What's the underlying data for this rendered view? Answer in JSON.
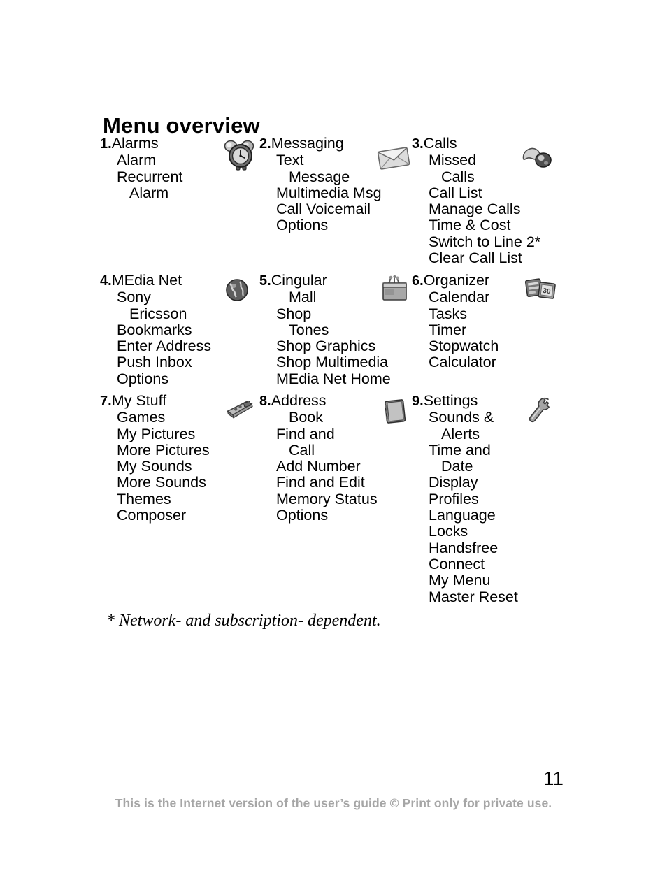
{
  "document": {
    "title": "Menu overview",
    "page_number": "11",
    "footnote": "* Network- and subscription- dependent.",
    "footer": "This is the Internet version of the user’s guide © Print only for private use.",
    "footer_color": "#a6a6a6"
  },
  "menu": {
    "sections": [
      {
        "number": "1.",
        "title": "Alarms",
        "icon": "alarm-clock-icon",
        "items": [
          {
            "text": "Alarm",
            "indent": false
          },
          {
            "text": "Recurrent",
            "indent": false
          },
          {
            "text": "Alarm",
            "indent": true
          }
        ]
      },
      {
        "number": "2.",
        "title": "Messaging",
        "icon": "envelope-icon",
        "items": [
          {
            "text": "Text",
            "indent": false
          },
          {
            "text": "Message",
            "indent": true
          },
          {
            "text": "Multimedia Msg",
            "indent": false
          },
          {
            "text": "Call Voicemail",
            "indent": false
          },
          {
            "text": "Options",
            "indent": false
          }
        ]
      },
      {
        "number": "3.",
        "title": "Calls",
        "icon": "phone-handset-icon",
        "items": [
          {
            "text": "Missed",
            "indent": false
          },
          {
            "text": "Calls",
            "indent": true
          },
          {
            "text": "Call List",
            "indent": false
          },
          {
            "text": "Manage Calls",
            "indent": false
          },
          {
            "text": "Time & Cost",
            "indent": false
          },
          {
            "text": "Switch to Line 2*",
            "indent": false
          },
          {
            "text": "Clear Call List",
            "indent": false
          }
        ]
      },
      {
        "number": "4.",
        "title": "MEdia Net",
        "icon": "globe-icon",
        "items": [
          {
            "text": "Sony",
            "indent": false
          },
          {
            "text": "Ericsson",
            "indent": true
          },
          {
            "text": "Bookmarks",
            "indent": false
          },
          {
            "text": "Enter Address",
            "indent": false
          },
          {
            "text": "Push Inbox",
            "indent": false
          },
          {
            "text": "Options",
            "indent": false
          }
        ]
      },
      {
        "number": "5.",
        "title": "Cingular",
        "icon": "shopping-bag-icon",
        "items": [
          {
            "text": "Mall",
            "indent": true
          },
          {
            "text": "Shop",
            "indent": false
          },
          {
            "text": "Tones",
            "indent": true
          },
          {
            "text": "Shop Graphics",
            "indent": false
          },
          {
            "text": "Shop Multimedia",
            "indent": false
          },
          {
            "text": "MEdia Net Home",
            "indent": false
          }
        ]
      },
      {
        "number": "6.",
        "title": "Organizer",
        "icon": "calendar-cards-icon",
        "items": [
          {
            "text": "Calendar",
            "indent": false
          },
          {
            "text": "Tasks",
            "indent": false
          },
          {
            "text": "Timer",
            "indent": false
          },
          {
            "text": "Stopwatch",
            "indent": false
          },
          {
            "text": "Calculator",
            "indent": false
          }
        ]
      },
      {
        "number": "7.",
        "title": "My Stuff",
        "icon": "game-controller-icon",
        "items": [
          {
            "text": "Games",
            "indent": false
          },
          {
            "text": "My Pictures",
            "indent": false
          },
          {
            "text": "More Pictures",
            "indent": false
          },
          {
            "text": "My Sounds",
            "indent": false
          },
          {
            "text": "More Sounds",
            "indent": false
          },
          {
            "text": "Themes",
            "indent": false
          },
          {
            "text": "Composer",
            "indent": false
          }
        ]
      },
      {
        "number": "8.",
        "title": "Address",
        "icon": "address-book-icon",
        "items": [
          {
            "text": "Book",
            "indent": true
          },
          {
            "text": "Find and",
            "indent": false
          },
          {
            "text": "Call",
            "indent": true
          },
          {
            "text": "Add Number",
            "indent": false
          },
          {
            "text": "Find and Edit",
            "indent": false
          },
          {
            "text": "Memory Status",
            "indent": false
          },
          {
            "text": "Options",
            "indent": false
          }
        ]
      },
      {
        "number": "9.",
        "title": "Settings",
        "icon": "wrench-icon",
        "items": [
          {
            "text": "Sounds &",
            "indent": false
          },
          {
            "text": "Alerts",
            "indent": true
          },
          {
            "text": "Time and",
            "indent": false
          },
          {
            "text": "Date",
            "indent": true
          },
          {
            "text": "Display",
            "indent": false
          },
          {
            "text": "Profiles",
            "indent": false
          },
          {
            "text": "Language",
            "indent": false
          },
          {
            "text": "Locks",
            "indent": false
          },
          {
            "text": "Handsfree",
            "indent": false
          },
          {
            "text": "Connect",
            "indent": false
          },
          {
            "text": "My Menu",
            "indent": false
          },
          {
            "text": "Master Reset",
            "indent": false
          }
        ]
      }
    ]
  }
}
